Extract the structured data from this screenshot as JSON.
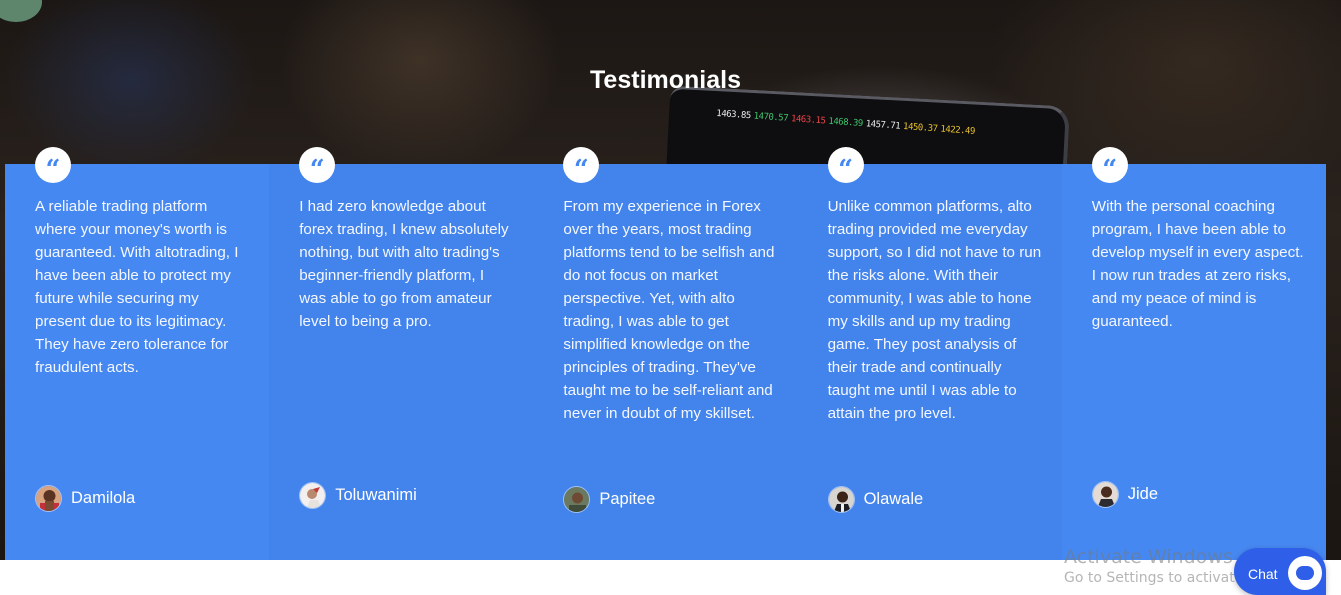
{
  "section": {
    "title": "Testimonials"
  },
  "background": {
    "ticker": [
      {
        "text": "1463.85",
        "color": "#e9e9e9"
      },
      {
        "text": "1470.57",
        "color": "#3fc46b"
      },
      {
        "text": "1463.15",
        "color": "#e6464b"
      },
      {
        "text": "1468.39",
        "color": "#3fc46b"
      },
      {
        "text": "1457.71",
        "color": "#e9e9e9"
      },
      {
        "text": "1450.37",
        "color": "#e6c030"
      },
      {
        "text": "1422.49",
        "color": "#e6c030"
      }
    ]
  },
  "colors": {
    "card": "#4688f1",
    "card_alt": "#4283ec",
    "chat_button": "#2f5fe9"
  },
  "testimonials": [
    {
      "quote_icon": "quote-open-icon",
      "text": "A reliable trading platform where your money's worth is guaranteed. With altotrading, I have been able to protect my future while securing my present due to its legitimacy. They have zero tolerance for fraudulent acts.",
      "name": "Damilola"
    },
    {
      "quote_icon": "quote-open-icon",
      "text": "I had zero knowledge about forex trading, I knew absolutely nothing, but with alto trading's beginner-friendly platform, I was able to go from amateur level to being a pro.",
      "name": "Toluwanimi"
    },
    {
      "quote_icon": "quote-open-icon",
      "text": "From my experience in Forex over the years, most trading platforms tend to be selfish and do not focus on market perspective. Yet, with alto trading, I was able to get simplified knowledge on the principles of trading. They've taught me to be self-reliant and never in doubt of my skillset.",
      "name": "Papitee"
    },
    {
      "quote_icon": "quote-open-icon",
      "text": "Unlike common platforms, alto trading provided me everyday support, so I did not have to run the risks alone. With their community, I was able to hone my skills and up my trading game. They post analysis of their trade and continually taught me until I was able to attain the pro level.",
      "name": "Olawale"
    },
    {
      "quote_icon": "quote-open-icon",
      "text": "With the personal coaching program, I have been able to develop myself in every aspect. I now run trades at zero risks, and my peace of mind is guaranteed.",
      "name": "Jide"
    }
  ],
  "quote_glyph": "“",
  "watermark": {
    "title": "Activate Windows",
    "subtitle": "Go to Settings to activate Windows."
  },
  "chat": {
    "label": "Chat",
    "icon": "chat-bubble-icon"
  }
}
